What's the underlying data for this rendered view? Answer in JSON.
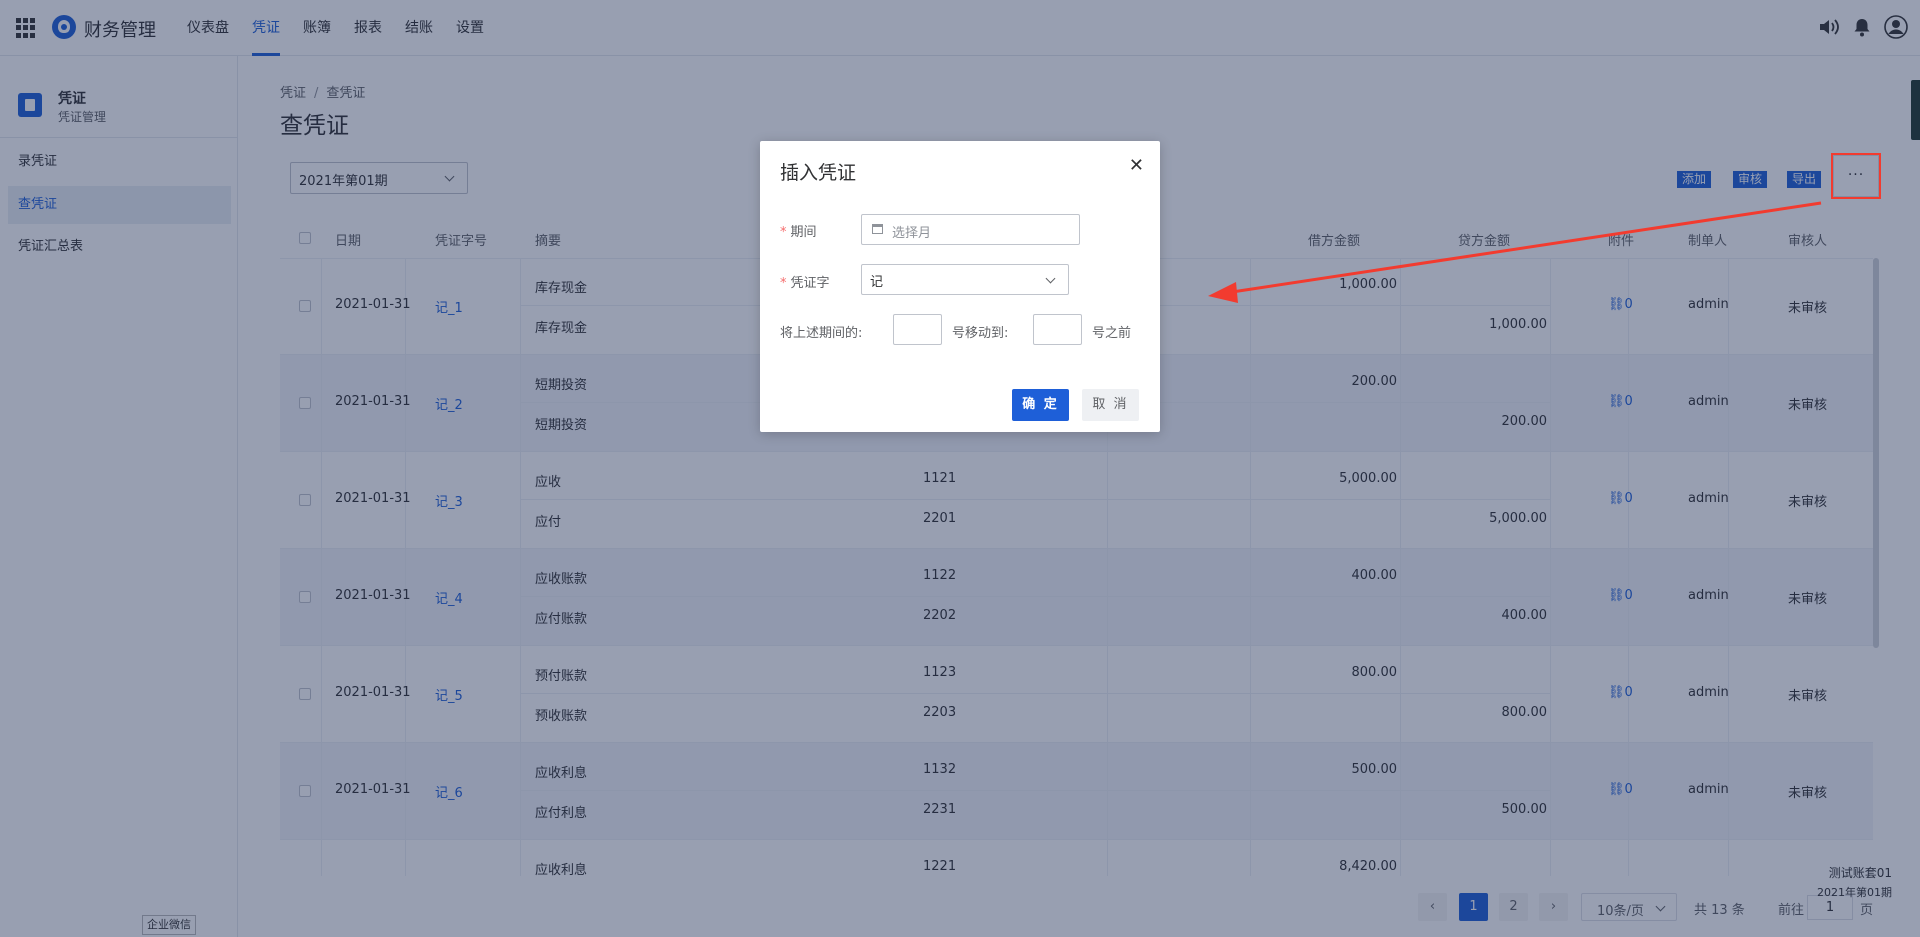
{
  "app": {
    "name": "财务管理"
  },
  "nav": [
    {
      "label": "仪表盘",
      "active": false
    },
    {
      "label": "凭证",
      "active": true
    },
    {
      "label": "账簿",
      "active": false
    },
    {
      "label": "报表",
      "active": false
    },
    {
      "label": "结账",
      "active": false
    },
    {
      "label": "设置",
      "active": false
    }
  ],
  "sidebar": {
    "title": "凭证",
    "subtitle": "凭证管理",
    "items": [
      {
        "label": "录凭证",
        "active": false
      },
      {
        "label": "查凭证",
        "active": true
      },
      {
        "label": "凭证汇总表",
        "active": false
      }
    ]
  },
  "breadcrumb": [
    "凭证",
    "/",
    "查凭证"
  ],
  "page_title": "查凭证",
  "period_select": "2021年第01期",
  "toolbar": {
    "add": "添加",
    "audit": "审核",
    "export": "导出",
    "more": "···"
  },
  "table": {
    "headers": [
      "日期",
      "凭证字号",
      "摘要",
      "借方金额",
      "贷方金额",
      "附件",
      "制单人",
      "审核人"
    ],
    "rows": [
      {
        "date": "2021-01-31",
        "no": "记_1",
        "lines": [
          {
            "summary": "库存现金",
            "code": "",
            "debit": "1,000.00",
            "credit": ""
          },
          {
            "summary": "库存现金",
            "code": "",
            "debit": "",
            "credit": "1,000.00"
          }
        ],
        "attach": "0",
        "maker": "admin",
        "auditor": "未审核"
      },
      {
        "date": "2021-01-31",
        "no": "记_2",
        "lines": [
          {
            "summary": "短期投资",
            "code": "",
            "debit": "200.00",
            "credit": ""
          },
          {
            "summary": "短期投资",
            "code": "",
            "debit": "",
            "credit": "200.00"
          }
        ],
        "attach": "0",
        "maker": "admin",
        "auditor": "未审核"
      },
      {
        "date": "2021-01-31",
        "no": "记_3",
        "lines": [
          {
            "summary": "应收",
            "code": "1121",
            "debit": "5,000.00",
            "credit": ""
          },
          {
            "summary": "应付",
            "code": "2201",
            "debit": "",
            "credit": "5,000.00"
          }
        ],
        "attach": "0",
        "maker": "admin",
        "auditor": "未审核"
      },
      {
        "date": "2021-01-31",
        "no": "记_4",
        "lines": [
          {
            "summary": "应收账款",
            "code": "1122",
            "debit": "400.00",
            "credit": ""
          },
          {
            "summary": "应付账款",
            "code": "2202",
            "debit": "",
            "credit": "400.00"
          }
        ],
        "attach": "0",
        "maker": "admin",
        "auditor": "未审核"
      },
      {
        "date": "2021-01-31",
        "no": "记_5",
        "lines": [
          {
            "summary": "预付账款",
            "code": "1123",
            "debit": "800.00",
            "credit": ""
          },
          {
            "summary": "预收账款",
            "code": "2203",
            "debit": "",
            "credit": "800.00"
          }
        ],
        "attach": "0",
        "maker": "admin",
        "auditor": "未审核"
      },
      {
        "date": "2021-01-31",
        "no": "记_6",
        "lines": [
          {
            "summary": "应收利息",
            "code": "1132",
            "debit": "500.00",
            "credit": ""
          },
          {
            "summary": "应付利息",
            "code": "2231",
            "debit": "",
            "credit": "500.00"
          }
        ],
        "attach": "0",
        "maker": "admin",
        "auditor": "未审核"
      },
      {
        "date": "",
        "no": "",
        "lines": [
          {
            "summary": "应收利息",
            "code": "1221",
            "debit": "8,420.00",
            "credit": ""
          }
        ],
        "attach": "",
        "maker": "",
        "auditor": ""
      }
    ]
  },
  "pagination": {
    "pages": [
      "1",
      "2"
    ],
    "current": "1",
    "page_size": "10条/页",
    "total": "共 13 条",
    "goto_prefix": "前往",
    "goto_value": "1",
    "goto_suffix": "页"
  },
  "account": {
    "name": "测试账套01",
    "period": "2021年第01期"
  },
  "wechat_tag": "企业微信",
  "dialog": {
    "title": "插入凭证",
    "period_label": "期间",
    "period_placeholder": "选择月",
    "word_label": "凭证字",
    "word_value": "记",
    "move_prefix": "将上述期间的:",
    "move_middle": "号移动到:",
    "move_suffix": "号之前",
    "confirm": "确 定",
    "cancel": "取 消"
  },
  "colors": {
    "accent": "#1e5fd8",
    "annotation": "#f23b2f",
    "overlay": "rgba(26,42,82,0.45)"
  }
}
